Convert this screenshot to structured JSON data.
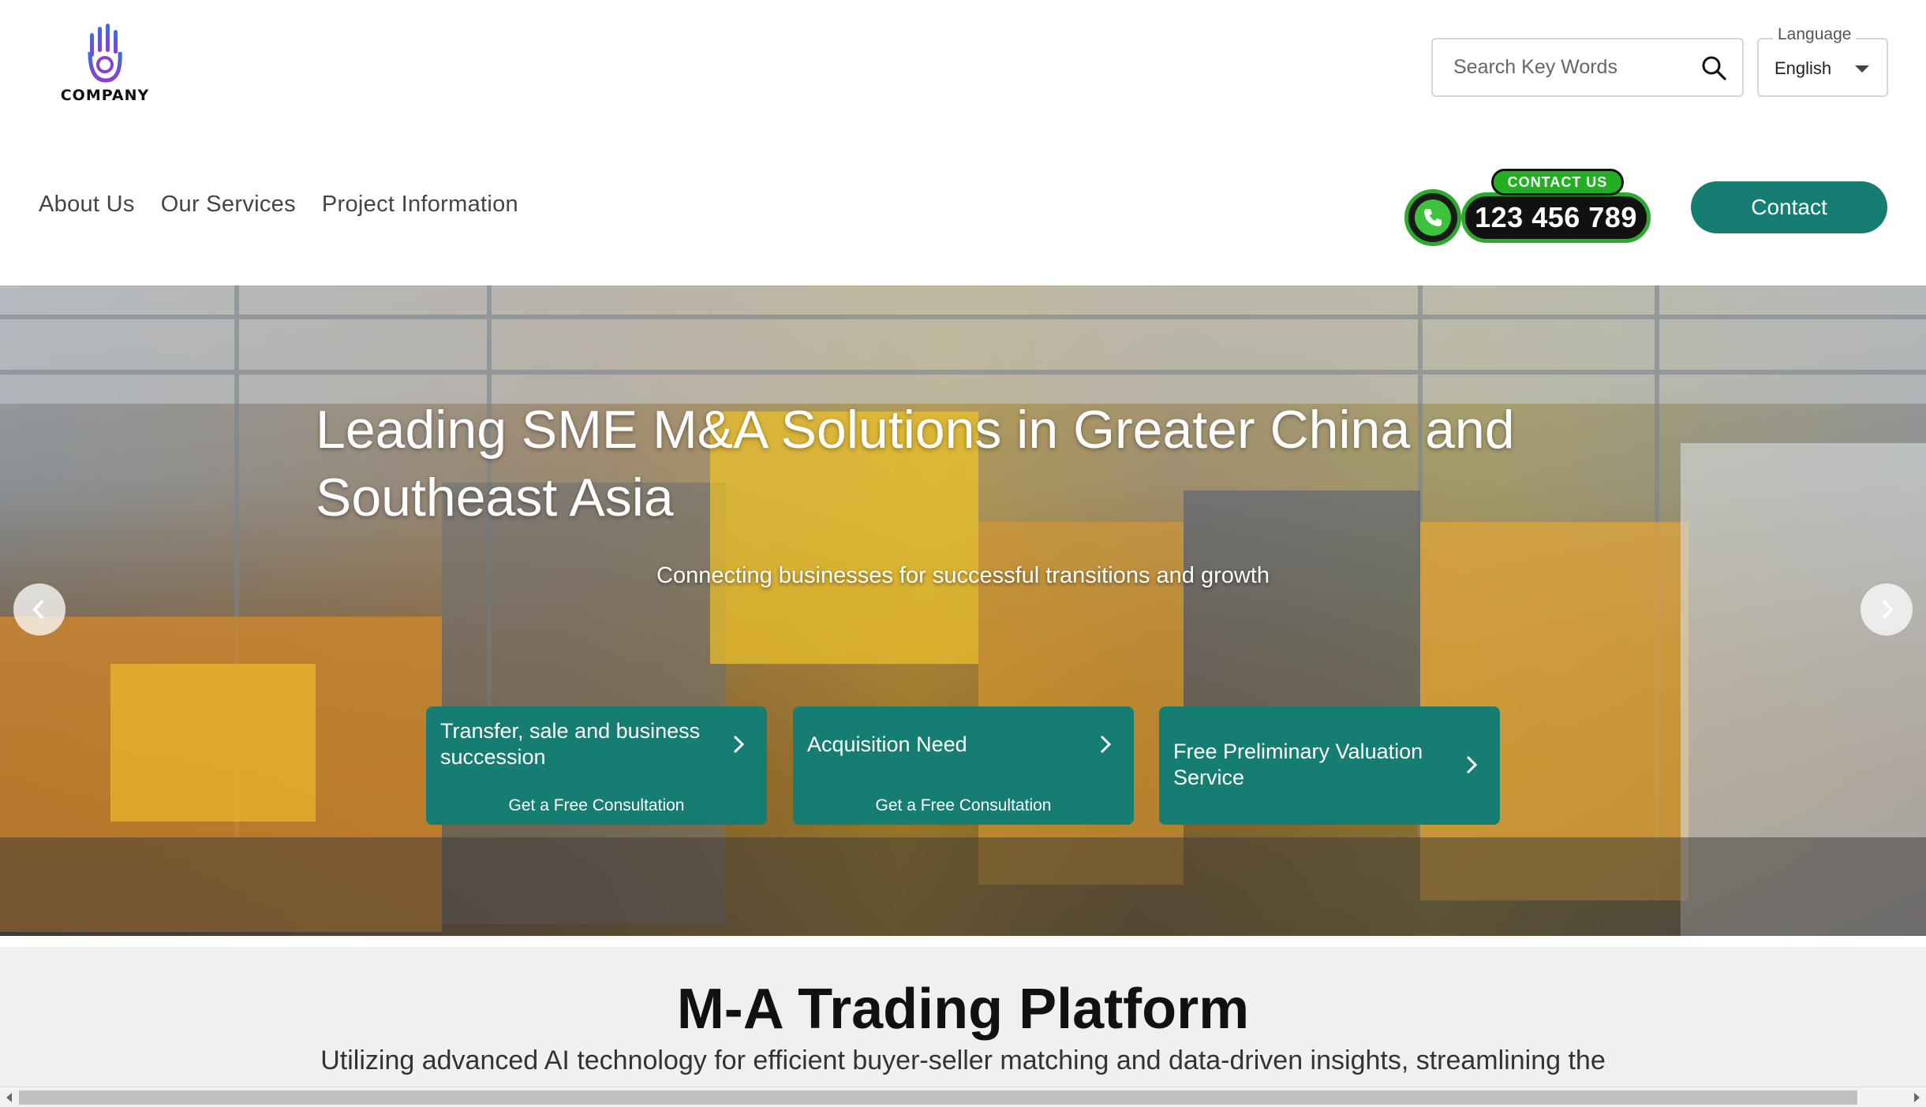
{
  "header": {
    "logo_text": "COMPANY",
    "search": {
      "placeholder": "Search Key Words",
      "icon": "search-icon"
    },
    "language": {
      "label": "Language",
      "value": "English"
    }
  },
  "nav": {
    "items": [
      {
        "label": "About Us"
      },
      {
        "label": "Our Services"
      },
      {
        "label": "Project Information"
      }
    ],
    "phone": {
      "tag": "CONTACT US",
      "number": "123 456 789"
    },
    "contact_label": "Contact"
  },
  "hero": {
    "title": "Leading SME M&A Solutions in Greater China and Southeast Asia",
    "subtitle": "Connecting businesses for successful transitions and growth",
    "cards": [
      {
        "title": "Transfer, sale and business succession",
        "sub": "Get a Free Consultation"
      },
      {
        "title": "Acquisition Need",
        "sub": "Get a Free Consultation"
      },
      {
        "title": "Free Preliminary Valuation Service",
        "sub": ""
      }
    ]
  },
  "section": {
    "title": "M-A Trading Platform",
    "description": "Utilizing advanced AI technology for efficient buyer-seller matching and data-driven insights, streamlining the"
  },
  "colors": {
    "accent": "#167d73",
    "phone_green": "#2ea82e"
  }
}
